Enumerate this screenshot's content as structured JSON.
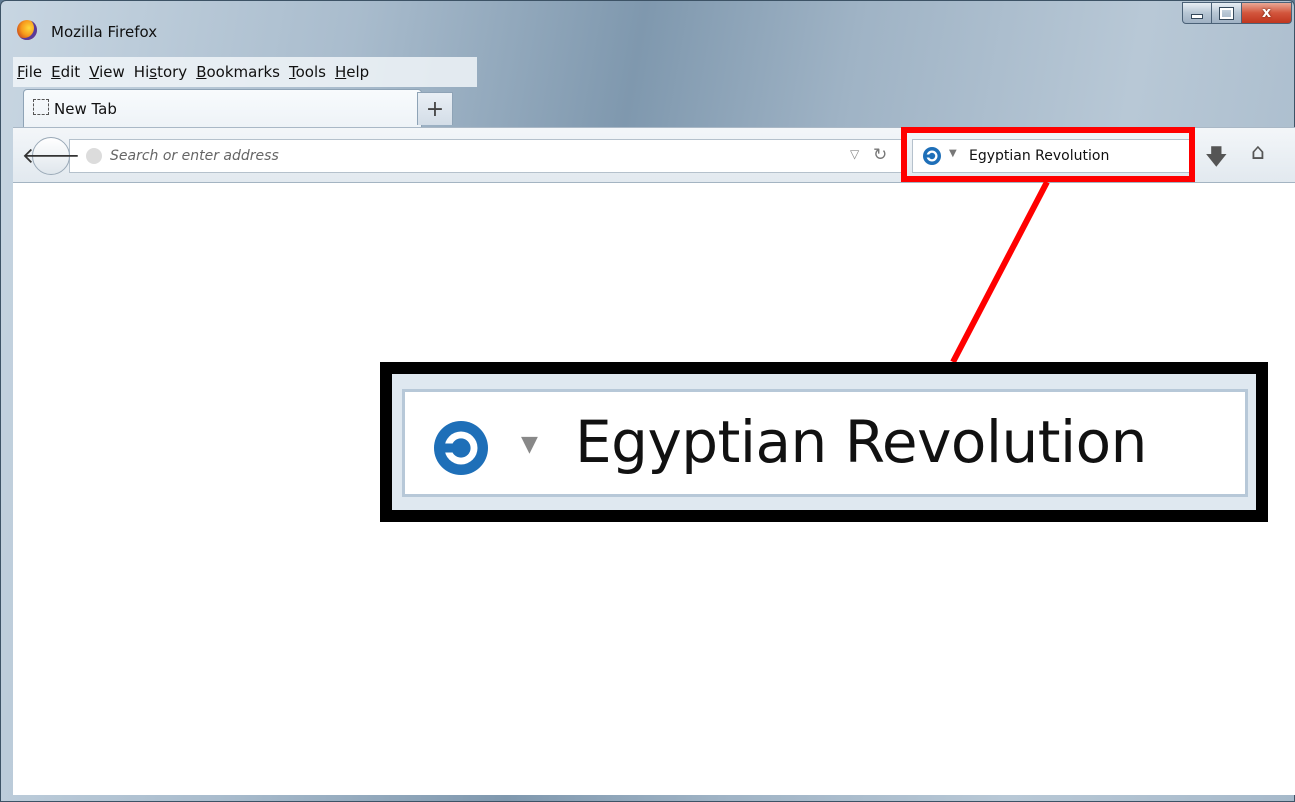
{
  "window": {
    "title": "Mozilla Firefox",
    "app_icon": "firefox-logo-icon",
    "controls": [
      "minimize-icon",
      "maximize-icon",
      "close-icon"
    ],
    "close_glyph": "x"
  },
  "menubar": {
    "items": [
      {
        "label": "File",
        "accel": "F",
        "rest": "ile"
      },
      {
        "label": "Edit",
        "accel": "E",
        "rest": "dit"
      },
      {
        "label": "View",
        "accel": "V",
        "rest": "iew"
      },
      {
        "label": "History",
        "pre": "Hi",
        "accel": "s",
        "rest": "tory"
      },
      {
        "label": "Bookmarks",
        "accel": "B",
        "rest": "ookmarks"
      },
      {
        "label": "Tools",
        "accel": "T",
        "rest": "ools"
      },
      {
        "label": "Help",
        "accel": "H",
        "rest": "elp"
      }
    ]
  },
  "tabs": [
    {
      "label": "New Tab",
      "icon": "blank-page-icon"
    }
  ],
  "new_tab_label": "+",
  "navbar": {
    "back_icon": "back-arrow-icon",
    "url_placeholder": "Search or enter address",
    "url_value": "",
    "search_engine_icon": "search-engine-icon",
    "search_value": "Egyptian Revolution",
    "download_icon": "download-arrow-icon",
    "home_icon": "home-icon"
  },
  "callout": {
    "search_value": "Egyptian Revolution",
    "highlight_color": "#ff0000",
    "frame_color": "#000000"
  },
  "colors": {
    "engine_blue": "#1e6fb8"
  }
}
